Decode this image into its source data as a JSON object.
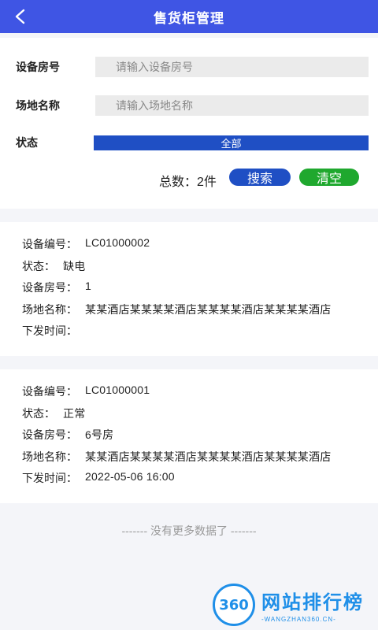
{
  "header": {
    "title": "售货柜管理",
    "back_icon": "chevron-left-icon"
  },
  "filters": {
    "room_label": "设备房号",
    "room_placeholder": "请输入设备房号",
    "room_value": "",
    "venue_label": "场地名称",
    "venue_placeholder": "请输入场地名称",
    "venue_value": "",
    "status_label": "状态",
    "status_selected": "全部"
  },
  "actions": {
    "total_text": "总数：2件",
    "search_label": "搜索",
    "clear_label": "清空"
  },
  "devices": [
    {
      "code_label": "设备编号：",
      "code": "LC01000002",
      "status_label": "状态：",
      "status": "缺电",
      "room_label": "设备房号：",
      "room": "1",
      "venue_label": "场地名称：",
      "venue": "某某酒店某某某某酒店某某某某酒店某某某某酒店",
      "time_label": "下发时间：",
      "time": ""
    },
    {
      "code_label": "设备编号：",
      "code": "LC01000001",
      "status_label": "状态：",
      "status": "正常",
      "room_label": "设备房号：",
      "room": "6号房",
      "venue_label": "场地名称：",
      "venue": "某某酒店某某某某酒店某某某某酒店某某某某酒店",
      "time_label": "下发时间：",
      "time": "2022-05-06 16:00"
    }
  ],
  "footer": {
    "no_more": "-------   没有更多数据了   -------"
  },
  "watermark": {
    "logo_text": "360",
    "name": "网站排行榜",
    "url": "-WANGZHAN360.CN-"
  },
  "colors": {
    "header_bg": "#3f55e4",
    "primary_blue": "#1f4fc4",
    "clear_green": "#1fa82e",
    "page_bg": "#f4f5f9"
  }
}
